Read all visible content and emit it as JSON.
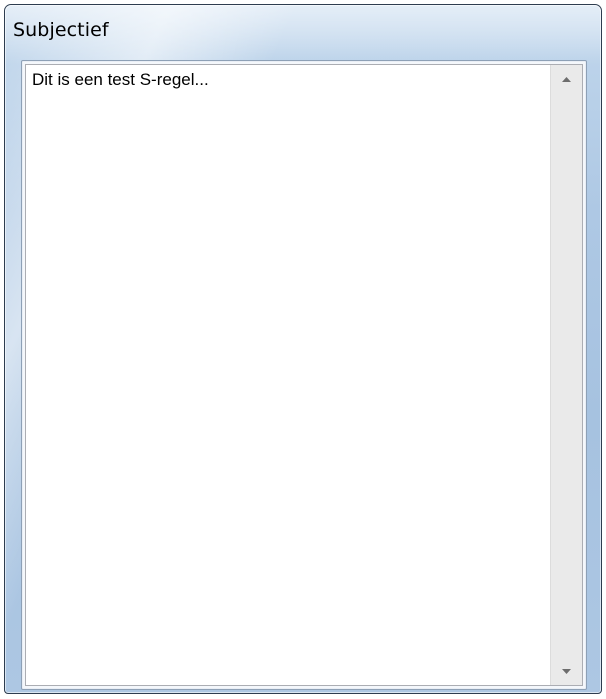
{
  "window": {
    "title": "Subjectief"
  },
  "textarea": {
    "value": "Dit is een test S-regel..."
  },
  "scrollbar": {
    "up_icon": "arrow-up-icon",
    "down_icon": "arrow-down-icon"
  },
  "colors": {
    "frame_blue": "#a6c2e0",
    "border_dark": "#2d3c4f",
    "textarea_bg": "#ffffff",
    "scrollbar_bg": "#eaeaea"
  }
}
